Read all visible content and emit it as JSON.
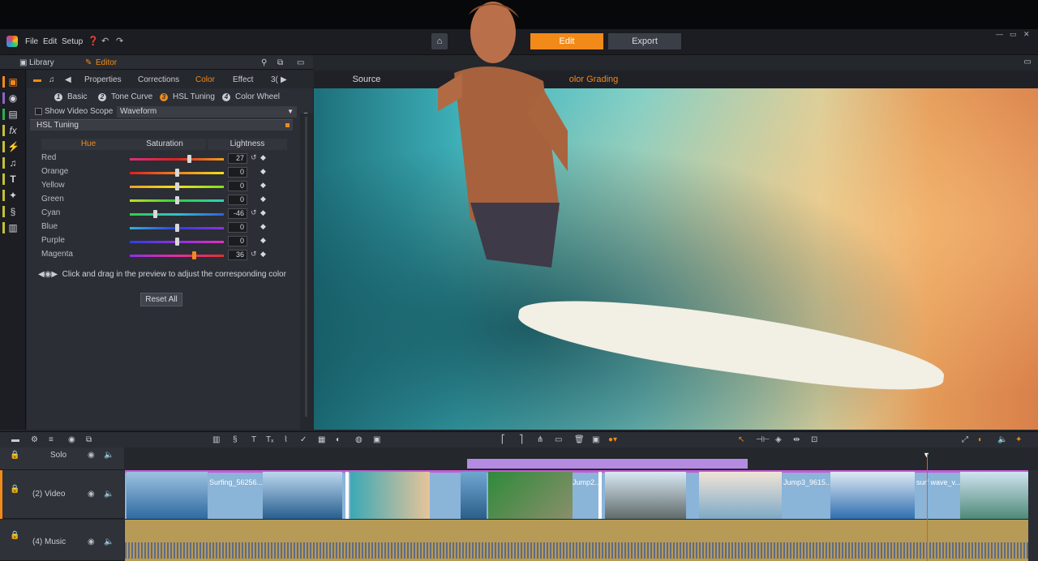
{
  "menu": {
    "file": "File",
    "edit": "Edit",
    "setup": "Setup"
  },
  "modes": {
    "edit": "Edit",
    "export": "Export"
  },
  "panel_tabs": {
    "library": "Library",
    "editor": "Editor"
  },
  "sub_tabs": [
    "Properties",
    "Corrections",
    "Color",
    "Effect",
    "3("
  ],
  "color_modes": [
    {
      "num": "1",
      "label": "Basic"
    },
    {
      "num": "2",
      "label": "Tone Curve"
    },
    {
      "num": "3",
      "label": "HSL Tuning"
    },
    {
      "num": "4",
      "label": "Color Wheel"
    }
  ],
  "scope": {
    "label": "Show Video Scope",
    "value": "Waveform"
  },
  "hsl": {
    "section": "HSL Tuning",
    "headers": [
      "Hue",
      "Saturation",
      "Lightness"
    ],
    "rows": [
      {
        "name": "Red",
        "value": "27",
        "pos": 0.63
      },
      {
        "name": "Orange",
        "value": "0",
        "pos": 0.5
      },
      {
        "name": "Yellow",
        "value": "0",
        "pos": 0.5
      },
      {
        "name": "Green",
        "value": "0",
        "pos": 0.5
      },
      {
        "name": "Cyan",
        "value": "-46",
        "pos": 0.27
      },
      {
        "name": "Blue",
        "value": "0",
        "pos": 0.5
      },
      {
        "name": "Purple",
        "value": "0",
        "pos": 0.5
      },
      {
        "name": "Magenta",
        "value": "36",
        "pos": 0.68
      }
    ],
    "hint": "Click and drag in the preview to adjust the corresponding color",
    "reset_all": "Reset All"
  },
  "preview_tabs": {
    "source": "Source",
    "grading": "olor Grading"
  },
  "tracks": {
    "solo": "Solo",
    "video": "(2) Video",
    "music": "(4) Music"
  },
  "clips": [
    "Surfing_56256...",
    "Jump2...",
    "Jump3_9615...",
    "surf wave_v..."
  ],
  "colors": {
    "accent": "#f28a1a",
    "video_bar": "#c45bd6",
    "music_bg": "#b79a55"
  }
}
